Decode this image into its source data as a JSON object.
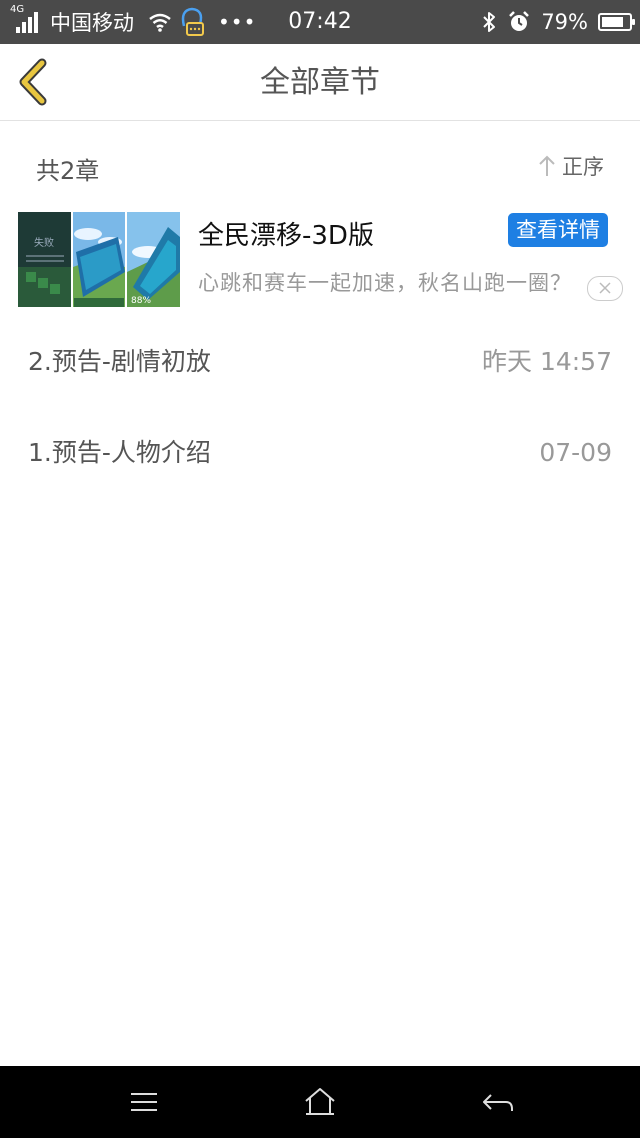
{
  "status_bar": {
    "network": "4G",
    "carrier": "中国移动",
    "time": "07:42",
    "battery": "79%",
    "battery_level": 0.79,
    "icons": [
      "signal-icon",
      "wifi-icon",
      "chat-notification-icon",
      "more-dots-icon",
      "bluetooth-icon",
      "alarm-icon",
      "battery-icon"
    ]
  },
  "header": {
    "title": "全部章节",
    "back_icon": "chevron-left-icon"
  },
  "summary": {
    "count": "共2章",
    "sort_label": "正序",
    "sort_icon": "arrow-up-icon"
  },
  "ad": {
    "title": "全民漂移-3D版",
    "button": "查看详情",
    "description": "心跳和赛车一起加速，秋名山跑一圈？",
    "image_caption_top": "失败",
    "image_percent": "88%",
    "close_icon": "close-icon"
  },
  "chapters": [
    {
      "title": "2.预告-剧情初放",
      "date": "昨天 14:57"
    },
    {
      "title": "1.预告-人物介绍",
      "date": "07-09"
    }
  ],
  "nav": {
    "icons": [
      "menu-icon",
      "home-icon",
      "back-arrow-icon"
    ]
  },
  "colors": {
    "accent": "#1e7fe3",
    "back_chevron": "#e0c13a",
    "status_bar": "#4a4a4a"
  }
}
